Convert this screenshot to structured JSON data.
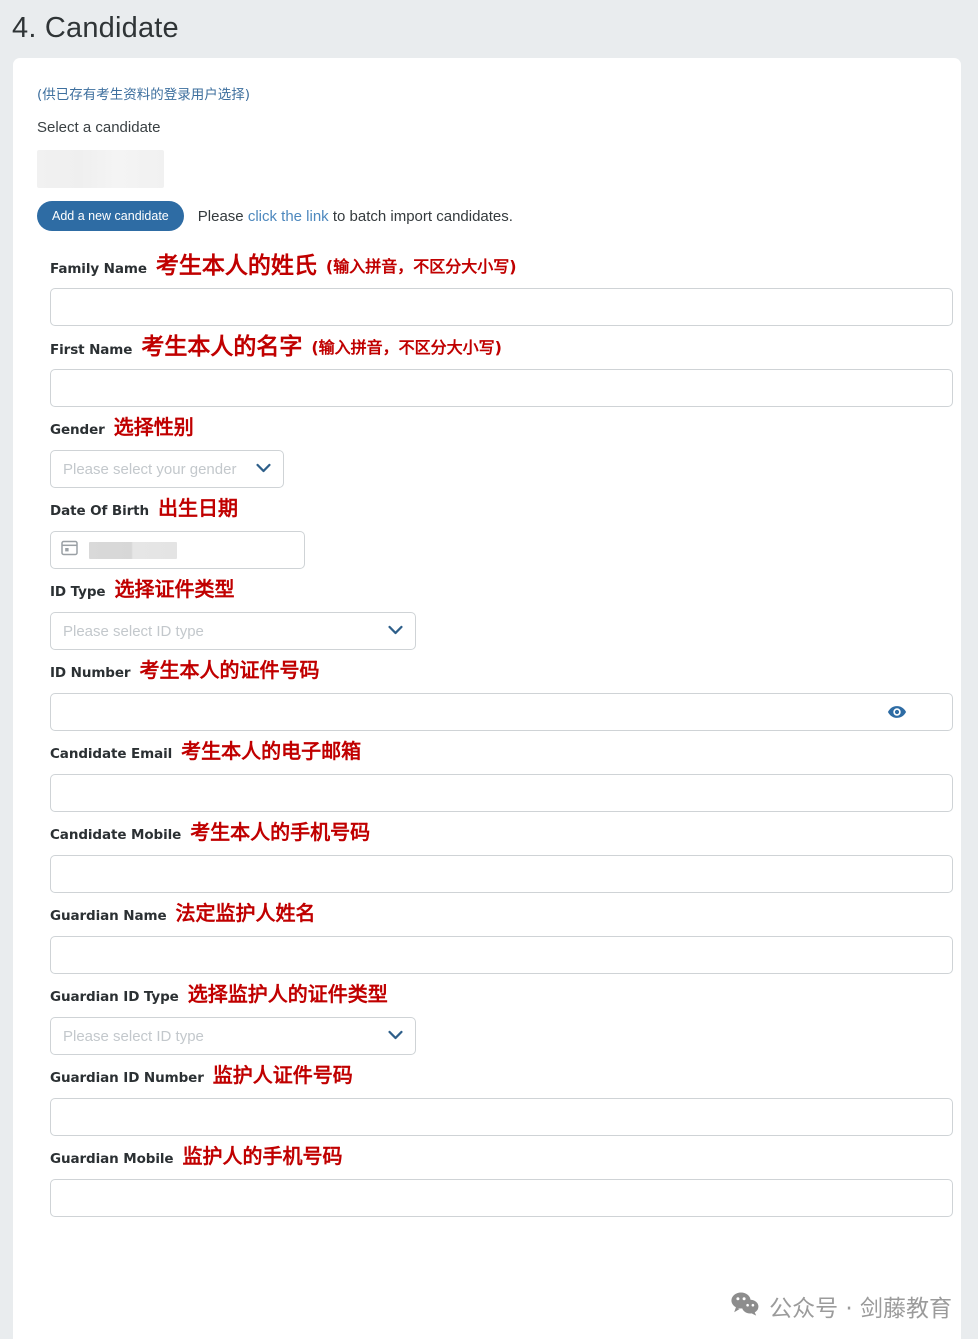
{
  "page": {
    "title": "4. Candidate"
  },
  "top": {
    "hint_cn": "(供已存有考生资料的登录用户选择)",
    "select_candidate_label": "Select a candidate",
    "add_button": "Add a new candidate",
    "batch_prefix": "Please ",
    "batch_link": "click the link",
    "batch_suffix": " to batch import candidates."
  },
  "colors": {
    "page_bg": "#e9ecee",
    "card_bg": "#ffffff",
    "accent_blue": "#2e6ca4",
    "link_blue": "#4d88be",
    "hint_blue": "#3d6f9e",
    "annotation_red": "#c00000",
    "border_gray": "#cfd3d6",
    "placeholder_gray": "#c3c8cc",
    "watermark_gray": "#9b9b9b"
  },
  "fields": [
    {
      "label": "Family Name",
      "annotation": "考生本人的姓氏",
      "annotation_note": "(输入拼音，不区分大小写)",
      "type": "text",
      "value": "",
      "placeholder": ""
    },
    {
      "label": "First Name",
      "annotation": "考生本人的名字",
      "annotation_note": "(输入拼音，不区分大小写)",
      "type": "text",
      "value": "",
      "placeholder": ""
    },
    {
      "label": "Gender",
      "annotation": "选择性别",
      "annotation_note": "",
      "type": "select",
      "placeholder": "Please select your gender",
      "value": ""
    },
    {
      "label": "Date Of Birth",
      "annotation": "出生日期",
      "annotation_note": "",
      "type": "date",
      "value": "",
      "placeholder": ""
    },
    {
      "label": "ID Type",
      "annotation": "选择证件类型",
      "annotation_note": "",
      "type": "select",
      "placeholder": "Please select ID type",
      "value": ""
    },
    {
      "label": "ID Number",
      "annotation": "考生本人的证件号码",
      "annotation_note": "",
      "type": "password",
      "value": "",
      "placeholder": ""
    },
    {
      "label": "Candidate Email",
      "annotation": "考生本人的电子邮箱",
      "annotation_note": "",
      "type": "text",
      "value": "",
      "placeholder": ""
    },
    {
      "label": "Candidate Mobile",
      "annotation": "考生本人的手机号码",
      "annotation_note": "",
      "type": "text",
      "value": "",
      "placeholder": ""
    },
    {
      "label": "Guardian Name",
      "annotation": "法定监护人姓名",
      "annotation_note": "",
      "type": "text",
      "value": "",
      "placeholder": ""
    },
    {
      "label": "Guardian ID Type",
      "annotation": "选择监护人的证件类型",
      "annotation_note": "",
      "type": "select",
      "placeholder": "Please select ID type",
      "value": ""
    },
    {
      "label": "Guardian ID Number",
      "annotation": "监护人证件号码",
      "annotation_note": "",
      "type": "text",
      "value": "",
      "placeholder": ""
    },
    {
      "label": "Guardian Mobile",
      "annotation": "监护人的手机号码",
      "annotation_note": "",
      "type": "text",
      "value": "",
      "placeholder": ""
    }
  ],
  "watermark": {
    "text": "公众号 · 剑藤教育",
    "icon": "wechat-icon"
  }
}
